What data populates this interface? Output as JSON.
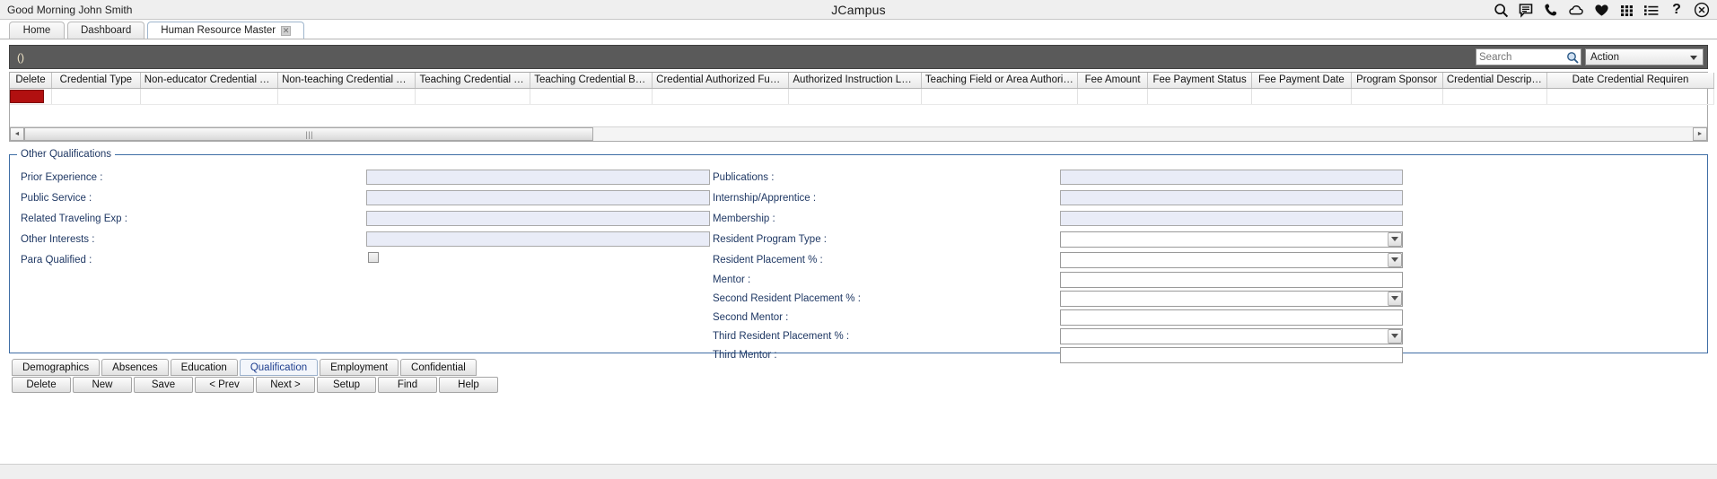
{
  "topbar": {
    "greeting": "Good Morning John Smith",
    "app_title": "JCampus",
    "icons": [
      {
        "name": "search-icon",
        "label": "search"
      },
      {
        "name": "chat-icon",
        "label": "messages"
      },
      {
        "name": "phone-icon",
        "label": "phone"
      },
      {
        "name": "cloud-icon",
        "label": "cloud"
      },
      {
        "name": "heart-icon",
        "label": "favorites"
      },
      {
        "name": "grid-apps-icon",
        "label": "apps"
      },
      {
        "name": "list-icon",
        "label": "list"
      },
      {
        "name": "help-icon",
        "label": "?"
      },
      {
        "name": "close-circle-icon",
        "label": "close"
      }
    ]
  },
  "window_tabs": [
    {
      "label": "Home",
      "active": false,
      "closable": false
    },
    {
      "label": "Dashboard",
      "active": false,
      "closable": false
    },
    {
      "label": "Human Resource Master",
      "active": true,
      "closable": true,
      "close_glyph": "✕"
    }
  ],
  "toolbar": {
    "breadcrumb": "()",
    "search_placeholder": "Search",
    "search_value": "",
    "action_label": "Action"
  },
  "grid": {
    "columns": [
      "Delete",
      "Credential Type",
      "Non-educator Credential Type",
      "Non-teaching Credential Type",
      "Teaching Credential Type",
      "Teaching Credential Basis",
      "Credential Authorized Function",
      "Authorized Instruction Level",
      "Teaching Field or Area Authorized",
      "Fee Amount",
      "Fee Payment Status",
      "Fee Payment Date",
      "Program Sponsor",
      "Credential Descripti...",
      "Date Credential Requiren"
    ],
    "rows": [
      {
        "delete": "delete-swatch"
      }
    ],
    "scroll_left_arrow": "◄",
    "scroll_right_arrow": "►",
    "scroll_grip": "⦀"
  },
  "qualifications": {
    "legend": "Other Qualifications",
    "left_fields": [
      {
        "label": "Prior Experience :",
        "value": "",
        "type": "text"
      },
      {
        "label": "Public Service :",
        "value": "",
        "type": "text"
      },
      {
        "label": "Related Traveling Exp :",
        "value": "",
        "type": "text"
      },
      {
        "label": "Other Interests :",
        "value": "",
        "type": "text"
      },
      {
        "label": "Para Qualified :",
        "value": "",
        "type": "checkbox",
        "checked": false
      }
    ],
    "right_fields": [
      {
        "label": "Publications :",
        "value": "",
        "type": "text"
      },
      {
        "label": "Internship/Apprentice :",
        "value": "",
        "type": "text"
      },
      {
        "label": "Membership :",
        "value": "",
        "type": "text"
      },
      {
        "label": "Resident Program Type :",
        "value": "",
        "type": "select"
      },
      {
        "label": "Resident Placement % :",
        "value": "",
        "type": "select"
      },
      {
        "label": "Mentor :",
        "value": "",
        "type": "input"
      },
      {
        "label": "Second Resident Placement % :",
        "value": "",
        "type": "select"
      },
      {
        "label": "Second Mentor :",
        "value": "",
        "type": "input"
      },
      {
        "label": "Third Resident Placement % :",
        "value": "",
        "type": "select"
      },
      {
        "label": "Third Mentor :",
        "value": "",
        "type": "input"
      }
    ]
  },
  "bottom_tabs": [
    {
      "label": "Demographics",
      "active": false
    },
    {
      "label": "Absences",
      "active": false
    },
    {
      "label": "Education",
      "active": false
    },
    {
      "label": "Qualification",
      "active": true
    },
    {
      "label": "Employment",
      "active": false
    },
    {
      "label": "Confidential",
      "active": false
    }
  ],
  "action_buttons": [
    {
      "label": "Delete"
    },
    {
      "label": "New"
    },
    {
      "label": "Save"
    },
    {
      "label": "< Prev"
    },
    {
      "label": "Next >"
    },
    {
      "label": "Setup"
    },
    {
      "label": "Find"
    },
    {
      "label": "Help"
    }
  ],
  "colors": {
    "delete_swatch": "#b11010",
    "label_blue": "#1f3864",
    "field_bg": "#e9ecf7",
    "toolbar_dark": "#5a5a5a",
    "fieldset_border": "#3f6ea5",
    "active_tab_text": "#1f3f8f"
  }
}
